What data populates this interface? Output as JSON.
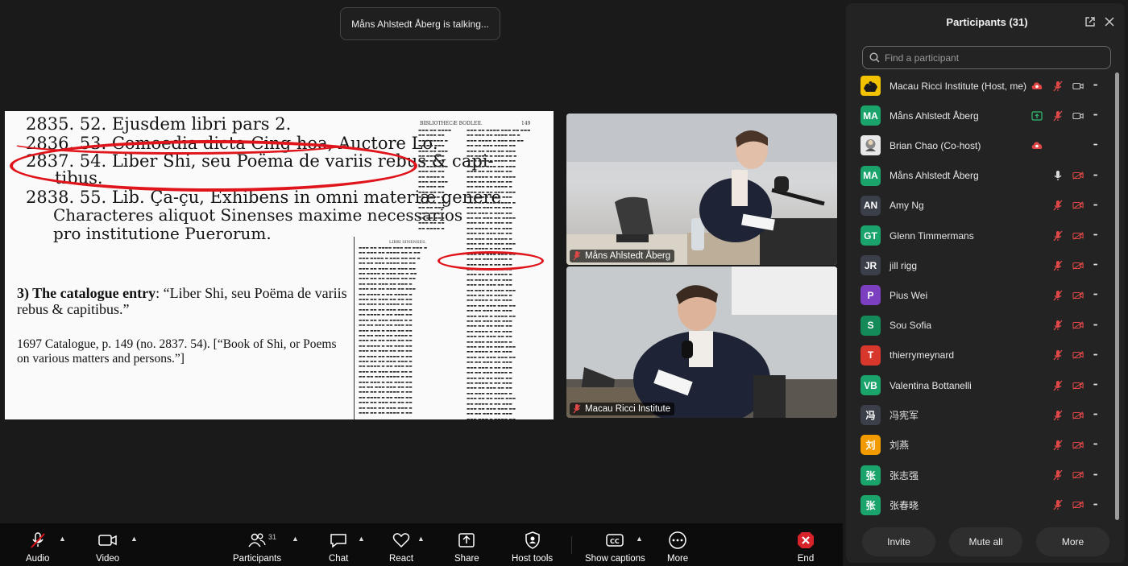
{
  "talking_banner": "Måns Ahlstedt Åberg is talking...",
  "shared_screen": {
    "scan_lines": [
      "2835. 52. Ejusdem libri pars 2.",
      "2836. 53. Comoedia dicta Cing hoa, Auctore Lo.",
      "2837. 54. Liber Shi, seu Poëma de variis rebus & capi-",
      "tibus.",
      "2838. 55. Lib. Ça-çu, Exhibens in omni materiæ genere",
      "Characteres aliquot Sinenses maxime necessarios",
      "pro institutione Puerorum."
    ],
    "entry_bold": "3) The catalogue entry",
    "entry_text": ": “Liber Shi, seu Poëma de variis rebus & capitibus.”",
    "citation": "1697 Catalogue, p. 149 (no. 2837. 54). [“Book of Shi, or Poems on various matters and persons.”]",
    "page_header": "BIBLIOTHECÆ BODLEII.",
    "page_number": "149",
    "section_header": "LIBRI SINENSES."
  },
  "videos": [
    {
      "name": "Måns Ahlstedt Åberg"
    },
    {
      "name": "Macau Ricci Institute"
    }
  ],
  "sidebar": {
    "title": "Participants (31)",
    "search_placeholder": "Find a participant",
    "participants": [
      {
        "initials": "",
        "name": "Macau Ricci Institute (Host, me)",
        "avatar_color": "#f2c200",
        "mic": "muted",
        "video": "on",
        "extra": "record"
      },
      {
        "initials": "MA",
        "name": "Måns Ahlstedt Åberg",
        "avatar_color": "#1aa36b",
        "mic": "muted",
        "video": "on",
        "extra": "share"
      },
      {
        "initials": "",
        "name": "Brian Chao (Co-host)",
        "avatar_color": "#e8e8e8",
        "mic": "none",
        "video": "none",
        "extra": "record"
      },
      {
        "initials": "MA",
        "name": "Måns Ahlstedt Åberg",
        "avatar_color": "#1aa36b",
        "mic": "on",
        "video": "off",
        "extra": ""
      },
      {
        "initials": "AN",
        "name": "Amy Ng",
        "avatar_color": "#3a3f4a",
        "mic": "muted",
        "video": "off",
        "extra": ""
      },
      {
        "initials": "GT",
        "name": "Glenn Timmermans",
        "avatar_color": "#1aa36b",
        "mic": "muted",
        "video": "off",
        "extra": ""
      },
      {
        "initials": "JR",
        "name": "jill rigg",
        "avatar_color": "#3a3f4a",
        "mic": "muted",
        "video": "off",
        "extra": ""
      },
      {
        "initials": "P",
        "name": "Pius Wei",
        "avatar_color": "#7b3fbf",
        "mic": "muted",
        "video": "off",
        "extra": ""
      },
      {
        "initials": "S",
        "name": "Sou Sofia",
        "avatar_color": "#138a57",
        "mic": "muted",
        "video": "off",
        "extra": ""
      },
      {
        "initials": "T",
        "name": "thierrymeynard",
        "avatar_color": "#d8382c",
        "mic": "muted",
        "video": "off",
        "extra": ""
      },
      {
        "initials": "VB",
        "name": "Valentina Bottanelli",
        "avatar_color": "#1aa36b",
        "mic": "muted",
        "video": "off",
        "extra": ""
      },
      {
        "initials": "冯",
        "name": "冯宪军",
        "avatar_color": "#3a3f4a",
        "mic": "muted",
        "video": "off",
        "extra": ""
      },
      {
        "initials": "刘",
        "name": "刘燕",
        "avatar_color": "#f29b00",
        "mic": "muted",
        "video": "off",
        "extra": ""
      },
      {
        "initials": "张",
        "name": "张志强",
        "avatar_color": "#1aa36b",
        "mic": "muted",
        "video": "off",
        "extra": ""
      },
      {
        "initials": "张",
        "name": "张春晓",
        "avatar_color": "#1aa36b",
        "mic": "muted",
        "video": "off",
        "extra": ""
      }
    ],
    "invite_label": "Invite",
    "mute_all_label": "Mute all",
    "more_label": "More"
  },
  "toolbar": {
    "audio": "Audio",
    "video": "Video",
    "participants": "Participants",
    "participants_count": "31",
    "chat": "Chat",
    "react": "React",
    "share": "Share",
    "host_tools": "Host tools",
    "show_captions": "Show captions",
    "more": "More",
    "end": "End"
  },
  "colors": {
    "accent_red": "#e0141b",
    "muted_red": "#e04848",
    "share_green": "#2fbf71"
  }
}
